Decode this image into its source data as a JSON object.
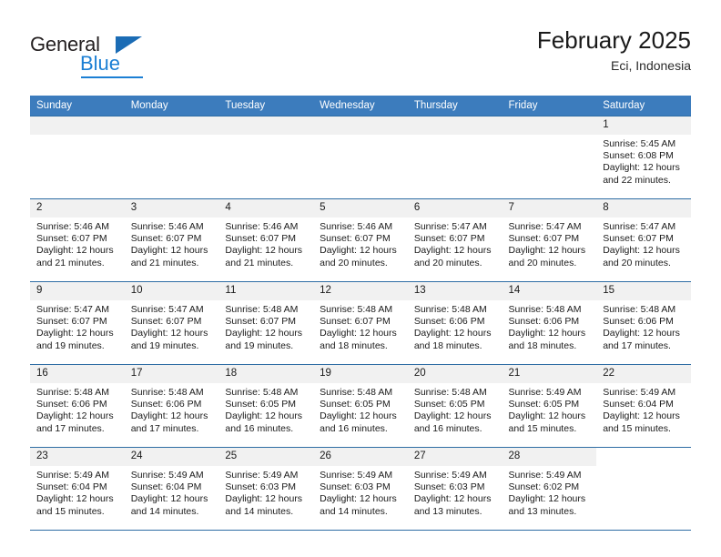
{
  "brand": {
    "name_dark": "General",
    "name_blue": "Blue",
    "accent_color": "#1b7fd4",
    "header_color": "#3c7cbd"
  },
  "header": {
    "title": "February 2025",
    "subtitle": "Eci, Indonesia"
  },
  "weekday_headers": [
    "Sunday",
    "Monday",
    "Tuesday",
    "Wednesday",
    "Thursday",
    "Friday",
    "Saturday"
  ],
  "labels": {
    "sunrise_prefix": "Sunrise:",
    "sunset_prefix": "Sunset:",
    "daylight_prefix": "Daylight:"
  },
  "weeks": [
    [
      {
        "day": "",
        "empty": true
      },
      {
        "day": "",
        "empty": true
      },
      {
        "day": "",
        "empty": true
      },
      {
        "day": "",
        "empty": true
      },
      {
        "day": "",
        "empty": true
      },
      {
        "day": "",
        "empty": true
      },
      {
        "day": "1",
        "sunrise": "Sunrise: 5:45 AM",
        "sunset": "Sunset: 6:08 PM",
        "daylight": "Daylight: 12 hours and 22 minutes."
      }
    ],
    [
      {
        "day": "2",
        "sunrise": "Sunrise: 5:46 AM",
        "sunset": "Sunset: 6:07 PM",
        "daylight": "Daylight: 12 hours and 21 minutes."
      },
      {
        "day": "3",
        "sunrise": "Sunrise: 5:46 AM",
        "sunset": "Sunset: 6:07 PM",
        "daylight": "Daylight: 12 hours and 21 minutes."
      },
      {
        "day": "4",
        "sunrise": "Sunrise: 5:46 AM",
        "sunset": "Sunset: 6:07 PM",
        "daylight": "Daylight: 12 hours and 21 minutes."
      },
      {
        "day": "5",
        "sunrise": "Sunrise: 5:46 AM",
        "sunset": "Sunset: 6:07 PM",
        "daylight": "Daylight: 12 hours and 20 minutes."
      },
      {
        "day": "6",
        "sunrise": "Sunrise: 5:47 AM",
        "sunset": "Sunset: 6:07 PM",
        "daylight": "Daylight: 12 hours and 20 minutes."
      },
      {
        "day": "7",
        "sunrise": "Sunrise: 5:47 AM",
        "sunset": "Sunset: 6:07 PM",
        "daylight": "Daylight: 12 hours and 20 minutes."
      },
      {
        "day": "8",
        "sunrise": "Sunrise: 5:47 AM",
        "sunset": "Sunset: 6:07 PM",
        "daylight": "Daylight: 12 hours and 20 minutes."
      }
    ],
    [
      {
        "day": "9",
        "sunrise": "Sunrise: 5:47 AM",
        "sunset": "Sunset: 6:07 PM",
        "daylight": "Daylight: 12 hours and 19 minutes."
      },
      {
        "day": "10",
        "sunrise": "Sunrise: 5:47 AM",
        "sunset": "Sunset: 6:07 PM",
        "daylight": "Daylight: 12 hours and 19 minutes."
      },
      {
        "day": "11",
        "sunrise": "Sunrise: 5:48 AM",
        "sunset": "Sunset: 6:07 PM",
        "daylight": "Daylight: 12 hours and 19 minutes."
      },
      {
        "day": "12",
        "sunrise": "Sunrise: 5:48 AM",
        "sunset": "Sunset: 6:07 PM",
        "daylight": "Daylight: 12 hours and 18 minutes."
      },
      {
        "day": "13",
        "sunrise": "Sunrise: 5:48 AM",
        "sunset": "Sunset: 6:06 PM",
        "daylight": "Daylight: 12 hours and 18 minutes."
      },
      {
        "day": "14",
        "sunrise": "Sunrise: 5:48 AM",
        "sunset": "Sunset: 6:06 PM",
        "daylight": "Daylight: 12 hours and 18 minutes."
      },
      {
        "day": "15",
        "sunrise": "Sunrise: 5:48 AM",
        "sunset": "Sunset: 6:06 PM",
        "daylight": "Daylight: 12 hours and 17 minutes."
      }
    ],
    [
      {
        "day": "16",
        "sunrise": "Sunrise: 5:48 AM",
        "sunset": "Sunset: 6:06 PM",
        "daylight": "Daylight: 12 hours and 17 minutes."
      },
      {
        "day": "17",
        "sunrise": "Sunrise: 5:48 AM",
        "sunset": "Sunset: 6:06 PM",
        "daylight": "Daylight: 12 hours and 17 minutes."
      },
      {
        "day": "18",
        "sunrise": "Sunrise: 5:48 AM",
        "sunset": "Sunset: 6:05 PM",
        "daylight": "Daylight: 12 hours and 16 minutes."
      },
      {
        "day": "19",
        "sunrise": "Sunrise: 5:48 AM",
        "sunset": "Sunset: 6:05 PM",
        "daylight": "Daylight: 12 hours and 16 minutes."
      },
      {
        "day": "20",
        "sunrise": "Sunrise: 5:48 AM",
        "sunset": "Sunset: 6:05 PM",
        "daylight": "Daylight: 12 hours and 16 minutes."
      },
      {
        "day": "21",
        "sunrise": "Sunrise: 5:49 AM",
        "sunset": "Sunset: 6:05 PM",
        "daylight": "Daylight: 12 hours and 15 minutes."
      },
      {
        "day": "22",
        "sunrise": "Sunrise: 5:49 AM",
        "sunset": "Sunset: 6:04 PM",
        "daylight": "Daylight: 12 hours and 15 minutes."
      }
    ],
    [
      {
        "day": "23",
        "sunrise": "Sunrise: 5:49 AM",
        "sunset": "Sunset: 6:04 PM",
        "daylight": "Daylight: 12 hours and 15 minutes."
      },
      {
        "day": "24",
        "sunrise": "Sunrise: 5:49 AM",
        "sunset": "Sunset: 6:04 PM",
        "daylight": "Daylight: 12 hours and 14 minutes."
      },
      {
        "day": "25",
        "sunrise": "Sunrise: 5:49 AM",
        "sunset": "Sunset: 6:03 PM",
        "daylight": "Daylight: 12 hours and 14 minutes."
      },
      {
        "day": "26",
        "sunrise": "Sunrise: 5:49 AM",
        "sunset": "Sunset: 6:03 PM",
        "daylight": "Daylight: 12 hours and 14 minutes."
      },
      {
        "day": "27",
        "sunrise": "Sunrise: 5:49 AM",
        "sunset": "Sunset: 6:03 PM",
        "daylight": "Daylight: 12 hours and 13 minutes."
      },
      {
        "day": "28",
        "sunrise": "Sunrise: 5:49 AM",
        "sunset": "Sunset: 6:02 PM",
        "daylight": "Daylight: 12 hours and 13 minutes."
      },
      {
        "day": "",
        "blank": true
      }
    ]
  ]
}
